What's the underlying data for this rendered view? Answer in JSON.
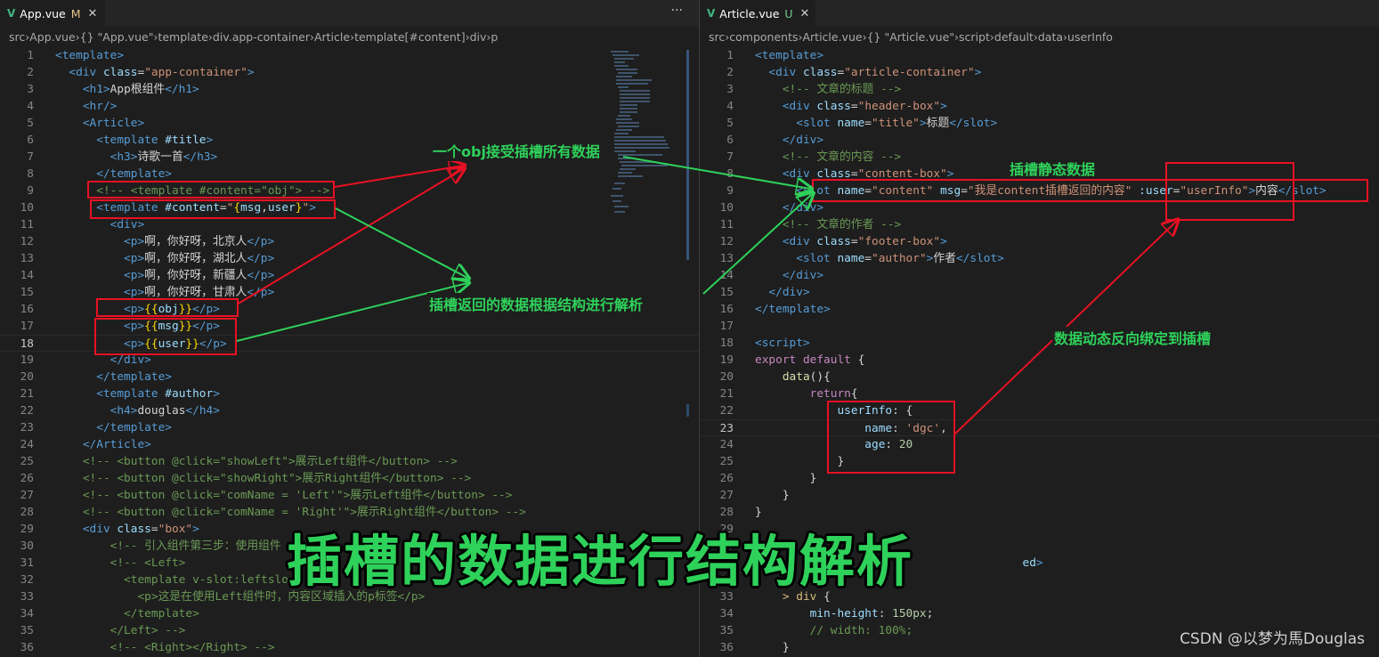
{
  "left": {
    "tab": {
      "label": "App.vue",
      "badge": "M"
    },
    "breadcrumb": [
      "src",
      "App.vue",
      "{} \"App.vue\"",
      "template",
      "div.app-container",
      "Article",
      "template[#content]",
      "div",
      "p"
    ],
    "current_line": 18,
    "lines": [
      [
        [
          "t-tag",
          "<template>"
        ]
      ],
      [
        [
          "t-text",
          "  "
        ],
        [
          "t-tag",
          "<div "
        ],
        [
          "t-attr",
          "class"
        ],
        [
          "t-text",
          "="
        ],
        [
          "t-str",
          "\"app-container\""
        ],
        [
          "t-tag",
          ">"
        ]
      ],
      [
        [
          "t-text",
          "    "
        ],
        [
          "t-tag",
          "<h1>"
        ],
        [
          "t-text",
          "App根组件"
        ],
        [
          "t-tag",
          "</h1>"
        ]
      ],
      [
        [
          "t-text",
          "    "
        ],
        [
          "t-tag",
          "<hr/>"
        ]
      ],
      [
        [
          "t-text",
          "    "
        ],
        [
          "t-tag",
          "<Article>"
        ]
      ],
      [
        [
          "t-text",
          "      "
        ],
        [
          "t-tag",
          "<template "
        ],
        [
          "t-attr",
          "#title"
        ],
        [
          "t-tag",
          ">"
        ]
      ],
      [
        [
          "t-text",
          "        "
        ],
        [
          "t-tag",
          "<h3>"
        ],
        [
          "t-text",
          "诗歌一首"
        ],
        [
          "t-tag",
          "</h3>"
        ]
      ],
      [
        [
          "t-text",
          "      "
        ],
        [
          "t-tag",
          "</template>"
        ]
      ],
      [
        [
          "t-text",
          "      "
        ],
        [
          "t-com",
          "<!-- <template #content=\"obj\"> -->"
        ]
      ],
      [
        [
          "t-text",
          "      "
        ],
        [
          "t-tag",
          "<template "
        ],
        [
          "t-attr",
          "#content"
        ],
        [
          "t-text",
          "="
        ],
        [
          "t-str",
          "\""
        ],
        [
          "t-mus",
          "{"
        ],
        [
          "t-attr",
          "msg"
        ],
        [
          "t-text",
          ","
        ],
        [
          "t-attr",
          "user"
        ],
        [
          "t-mus",
          "}"
        ],
        [
          "t-str",
          "\""
        ],
        [
          "t-tag",
          ">"
        ]
      ],
      [
        [
          "t-text",
          "        "
        ],
        [
          "t-tag",
          "<div>"
        ]
      ],
      [
        [
          "t-text",
          "          "
        ],
        [
          "t-tag",
          "<p>"
        ],
        [
          "t-text",
          "啊，你好呀，北京人"
        ],
        [
          "t-tag",
          "</p>"
        ]
      ],
      [
        [
          "t-text",
          "          "
        ],
        [
          "t-tag",
          "<p>"
        ],
        [
          "t-text",
          "啊，你好呀，湖北人"
        ],
        [
          "t-tag",
          "</p>"
        ]
      ],
      [
        [
          "t-text",
          "          "
        ],
        [
          "t-tag",
          "<p>"
        ],
        [
          "t-text",
          "啊，你好呀，新疆人"
        ],
        [
          "t-tag",
          "</p>"
        ]
      ],
      [
        [
          "t-text",
          "          "
        ],
        [
          "t-tag",
          "<p>"
        ],
        [
          "t-text",
          "啊，你好呀，甘肃人"
        ],
        [
          "t-tag",
          "</p>"
        ]
      ],
      [
        [
          "t-text",
          "          "
        ],
        [
          "t-tag",
          "<p>"
        ],
        [
          "t-mus",
          "{{"
        ],
        [
          "t-attr",
          "obj"
        ],
        [
          "t-mus",
          "}}"
        ],
        [
          "t-tag",
          "</p>"
        ]
      ],
      [
        [
          "t-text",
          "          "
        ],
        [
          "t-tag",
          "<p>"
        ],
        [
          "t-mus",
          "{{"
        ],
        [
          "t-attr",
          "msg"
        ],
        [
          "t-mus",
          "}}"
        ],
        [
          "t-tag",
          "</p>"
        ]
      ],
      [
        [
          "t-text",
          "          "
        ],
        [
          "t-tag",
          "<p>"
        ],
        [
          "t-mus",
          "{{"
        ],
        [
          "t-attr",
          "user"
        ],
        [
          "t-mus",
          "}}"
        ],
        [
          "t-tag",
          "</p>"
        ]
      ],
      [
        [
          "t-text",
          "        "
        ],
        [
          "t-tag",
          "</div>"
        ]
      ],
      [
        [
          "t-text",
          "      "
        ],
        [
          "t-tag",
          "</template>"
        ]
      ],
      [
        [
          "t-text",
          "      "
        ],
        [
          "t-tag",
          "<template "
        ],
        [
          "t-attr",
          "#author"
        ],
        [
          "t-tag",
          ">"
        ]
      ],
      [
        [
          "t-text",
          "        "
        ],
        [
          "t-tag",
          "<h4>"
        ],
        [
          "t-text",
          "douglas"
        ],
        [
          "t-tag",
          "</h4>"
        ]
      ],
      [
        [
          "t-text",
          "      "
        ],
        [
          "t-tag",
          "</template>"
        ]
      ],
      [
        [
          "t-text",
          "    "
        ],
        [
          "t-tag",
          "</Article>"
        ]
      ],
      [
        [
          "t-text",
          "    "
        ],
        [
          "t-com",
          "<!-- <button @click=\"showLeft\">展示Left组件</button> -->"
        ]
      ],
      [
        [
          "t-text",
          "    "
        ],
        [
          "t-com",
          "<!-- <button @click=\"showRight\">展示Right组件</button> -->"
        ]
      ],
      [
        [
          "t-text",
          "    "
        ],
        [
          "t-com",
          "<!-- <button @click=\"comName = 'Left'\">展示Left组件</button> -->"
        ]
      ],
      [
        [
          "t-text",
          "    "
        ],
        [
          "t-com",
          "<!-- <button @click=\"comName = 'Right'\">展示Right组件</button> -->"
        ]
      ],
      [
        [
          "t-text",
          "    "
        ],
        [
          "t-tag",
          "<div "
        ],
        [
          "t-attr",
          "class"
        ],
        [
          "t-text",
          "="
        ],
        [
          "t-str",
          "\"box\""
        ],
        [
          "t-tag",
          ">"
        ]
      ],
      [
        [
          "t-text",
          "        "
        ],
        [
          "t-com",
          "<!-- 引入组件第三步：使用组件"
        ]
      ],
      [
        [
          "t-text",
          "        "
        ],
        [
          "t-com",
          "<!-- <Left>"
        ]
      ],
      [
        [
          "t-text",
          "          "
        ],
        [
          "t-com",
          "<template v-slot:leftslo"
        ]
      ],
      [
        [
          "t-text",
          "            "
        ],
        [
          "t-com",
          "<p>这是在使用Left组件时，内容区域插入的p标签</p>"
        ]
      ],
      [
        [
          "t-text",
          "          "
        ],
        [
          "t-com",
          "</template>"
        ]
      ],
      [
        [
          "t-text",
          "        "
        ],
        [
          "t-com",
          "</Left> -->"
        ]
      ],
      [
        [
          "t-text",
          "        "
        ],
        [
          "t-com",
          "<!-- <Right></Right> -->"
        ]
      ]
    ]
  },
  "right": {
    "tab": {
      "label": "Article.vue",
      "badge": "U"
    },
    "breadcrumb": [
      "src",
      "components",
      "Article.vue",
      "{} \"Article.vue\"",
      "script",
      "default",
      "data",
      "userInfo"
    ],
    "current_line": 23,
    "lines": [
      [
        [
          "t-tag",
          "<template>"
        ]
      ],
      [
        [
          "t-text",
          "  "
        ],
        [
          "t-tag",
          "<div "
        ],
        [
          "t-attr",
          "class"
        ],
        [
          "t-text",
          "="
        ],
        [
          "t-str",
          "\"article-container\""
        ],
        [
          "t-tag",
          ">"
        ]
      ],
      [
        [
          "t-text",
          "    "
        ],
        [
          "t-com",
          "<!-- 文章的标题 -->"
        ]
      ],
      [
        [
          "t-text",
          "    "
        ],
        [
          "t-tag",
          "<div "
        ],
        [
          "t-attr",
          "class"
        ],
        [
          "t-text",
          "="
        ],
        [
          "t-str",
          "\"header-box\""
        ],
        [
          "t-tag",
          ">"
        ]
      ],
      [
        [
          "t-text",
          "      "
        ],
        [
          "t-tag",
          "<slot "
        ],
        [
          "t-attr",
          "name"
        ],
        [
          "t-text",
          "="
        ],
        [
          "t-str",
          "\"title\""
        ],
        [
          "t-tag",
          ">"
        ],
        [
          "t-text",
          "标题"
        ],
        [
          "t-tag",
          "</slot>"
        ]
      ],
      [
        [
          "t-text",
          "    "
        ],
        [
          "t-tag",
          "</div>"
        ]
      ],
      [
        [
          "t-text",
          "    "
        ],
        [
          "t-com",
          "<!-- 文章的内容 -->"
        ]
      ],
      [
        [
          "t-text",
          "    "
        ],
        [
          "t-tag",
          "<div "
        ],
        [
          "t-attr",
          "class"
        ],
        [
          "t-text",
          "="
        ],
        [
          "t-str",
          "\"content-box\""
        ],
        [
          "t-tag",
          ">"
        ]
      ],
      [
        [
          "t-text",
          "      "
        ],
        [
          "t-tag",
          "<slot "
        ],
        [
          "t-attr",
          "name"
        ],
        [
          "t-text",
          "="
        ],
        [
          "t-str",
          "\"content\""
        ],
        [
          "t-text",
          " "
        ],
        [
          "t-attr",
          "msg"
        ],
        [
          "t-text",
          "="
        ],
        [
          "t-str",
          "\"我是content插槽返回的内容\""
        ],
        [
          "t-text",
          " "
        ],
        [
          "t-attr",
          ":user"
        ],
        [
          "t-text",
          "="
        ],
        [
          "t-str",
          "\"userInfo\""
        ],
        [
          "t-tag",
          ">"
        ],
        [
          "t-text",
          "内容"
        ],
        [
          "t-tag",
          "</slot>"
        ]
      ],
      [
        [
          "t-text",
          "    "
        ],
        [
          "t-tag",
          "</div>"
        ]
      ],
      [
        [
          "t-text",
          "    "
        ],
        [
          "t-com",
          "<!-- 文章的作者 -->"
        ]
      ],
      [
        [
          "t-text",
          "    "
        ],
        [
          "t-tag",
          "<div "
        ],
        [
          "t-attr",
          "class"
        ],
        [
          "t-text",
          "="
        ],
        [
          "t-str",
          "\"footer-box\""
        ],
        [
          "t-tag",
          ">"
        ]
      ],
      [
        [
          "t-text",
          "      "
        ],
        [
          "t-tag",
          "<slot "
        ],
        [
          "t-attr",
          "name"
        ],
        [
          "t-text",
          "="
        ],
        [
          "t-str",
          "\"author\""
        ],
        [
          "t-tag",
          ">"
        ],
        [
          "t-text",
          "作者"
        ],
        [
          "t-tag",
          "</slot>"
        ]
      ],
      [
        [
          "t-text",
          "    "
        ],
        [
          "t-tag",
          "</div>"
        ]
      ],
      [
        [
          "t-text",
          "  "
        ],
        [
          "t-tag",
          "</div>"
        ]
      ],
      [
        [
          "t-tag",
          "</template>"
        ]
      ],
      [],
      [
        [
          "t-tag",
          "<script>"
        ]
      ],
      [
        [
          "t-kw",
          "export "
        ],
        [
          "t-kw",
          "default "
        ],
        [
          "t-punc",
          "{"
        ]
      ],
      [
        [
          "t-text",
          "    "
        ],
        [
          "t-fn",
          "data"
        ],
        [
          "t-punc",
          "(){"
        ]
      ],
      [
        [
          "t-text",
          "        "
        ],
        [
          "t-kw",
          "return"
        ],
        [
          "t-punc",
          "{"
        ]
      ],
      [
        [
          "t-text",
          "            "
        ],
        [
          "t-prop",
          "userInfo"
        ],
        [
          "t-punc",
          ": {"
        ]
      ],
      [
        [
          "t-text",
          "                "
        ],
        [
          "t-prop",
          "name"
        ],
        [
          "t-punc",
          ": "
        ],
        [
          "t-str",
          "'dgc'"
        ],
        [
          "t-punc",
          ","
        ]
      ],
      [
        [
          "t-text",
          "                "
        ],
        [
          "t-prop",
          "age"
        ],
        [
          "t-punc",
          ": "
        ],
        [
          "t-num",
          "20"
        ]
      ],
      [
        [
          "t-text",
          "            "
        ],
        [
          "t-punc",
          "}"
        ]
      ],
      [
        [
          "t-text",
          "        "
        ],
        [
          "t-punc",
          "}"
        ]
      ],
      [
        [
          "t-text",
          "    "
        ],
        [
          "t-punc",
          "}"
        ]
      ],
      [
        [
          "t-punc",
          "}"
        ]
      ],
      [],
      [],
      [
        [
          "t-text",
          "                                       "
        ],
        [
          "t-attr",
          "ed"
        ],
        [
          "t-tag",
          ">"
        ]
      ],
      [],
      [
        [
          "t-text",
          "    "
        ],
        [
          "t-sel",
          "> div "
        ],
        [
          "t-punc",
          "{"
        ]
      ],
      [
        [
          "t-text",
          "        "
        ],
        [
          "t-prop",
          "min-height"
        ],
        [
          "t-punc",
          ": "
        ],
        [
          "t-num",
          "150px"
        ],
        [
          "t-punc",
          ";"
        ]
      ],
      [
        [
          "t-text",
          "        "
        ],
        [
          "t-com",
          "// width: 100%;"
        ]
      ],
      [
        [
          "t-text",
          "    "
        ],
        [
          "t-punc",
          "}"
        ]
      ]
    ]
  },
  "annotations": {
    "obj_note": "一个obj接受插槽所有数据",
    "destructure_note": "插槽返回的数据根据结构进行解析",
    "static_note": "插槽静态数据",
    "dynamic_note": "数据动态反向绑定到插槽"
  },
  "title": "插槽的数据进行结构解析",
  "watermark": "CSDN @以梦为馬Douglas",
  "colors": {
    "annotation_green": "#2ed15a",
    "highlight_red": "#e81123",
    "vue_green": "#42b883"
  }
}
